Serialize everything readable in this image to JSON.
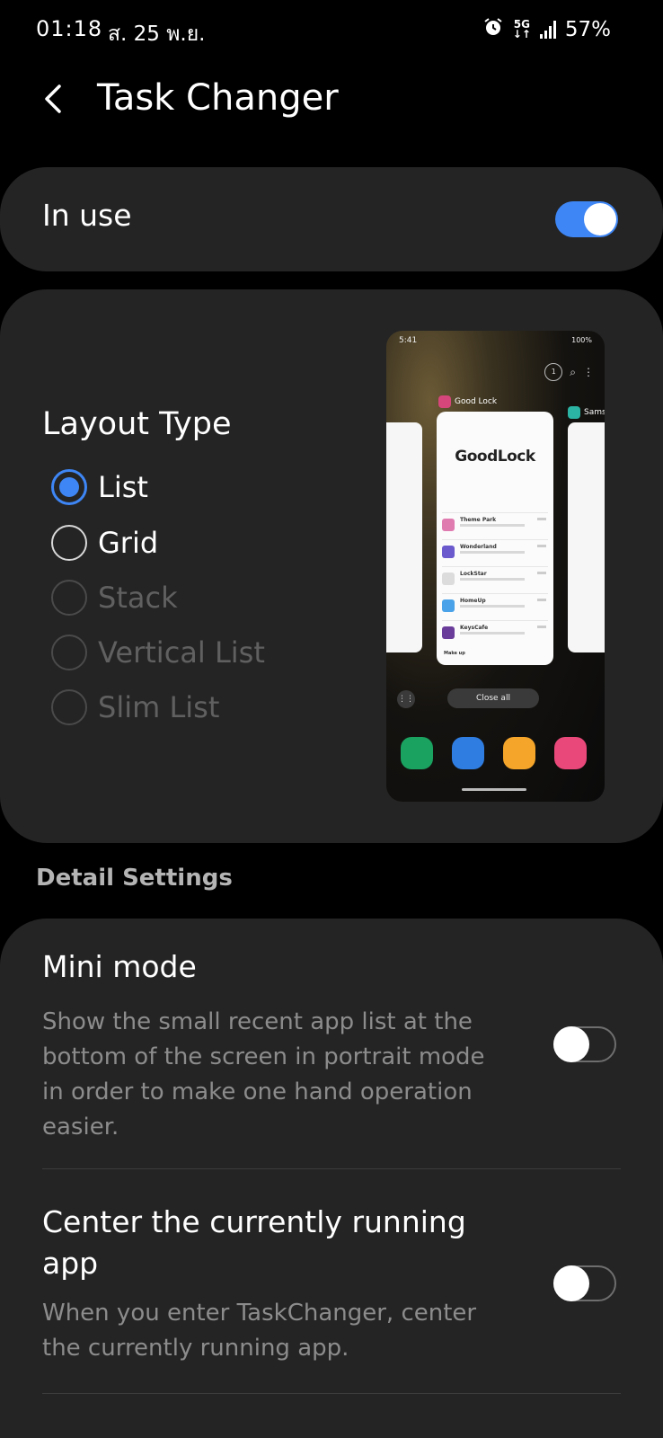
{
  "status_bar": {
    "time": "01:18",
    "date": "ส. 25 พ.ย.",
    "network": "5G",
    "battery": "57%"
  },
  "header": {
    "title": "Task Changer"
  },
  "in_use": {
    "label": "In use",
    "enabled": true
  },
  "layout": {
    "title": "Layout Type",
    "options": [
      {
        "label": "List",
        "selected": true,
        "enabled": true
      },
      {
        "label": "Grid",
        "selected": false,
        "enabled": true
      },
      {
        "label": "Stack",
        "selected": false,
        "enabled": false
      },
      {
        "label": "Vertical List",
        "selected": false,
        "enabled": false
      },
      {
        "label": "Slim List",
        "selected": false,
        "enabled": false
      }
    ],
    "preview": {
      "time": "5:41",
      "status": "100%",
      "badge": "1",
      "app_name": "Good Lock",
      "app_name_right": "Sams",
      "card_title": "GoodLock",
      "items": [
        "Theme Park",
        "Wonderland",
        "LockStar",
        "HomeUp",
        "KeysCafe"
      ],
      "footer": "Make up",
      "close_all": "Close all"
    }
  },
  "detail": {
    "section_title": "Detail Settings",
    "mini_mode": {
      "title": "Mini mode",
      "description_lines": [
        "Show the small recent app list at the",
        "bottom of the screen in portrait mode",
        "in order to make one hand operation",
        "easier."
      ],
      "enabled": false
    },
    "center_app": {
      "title_lines": [
        "Center the currently running",
        "app"
      ],
      "description_lines": [
        "When you enter TaskChanger, center",
        "the currently running app."
      ],
      "enabled": false
    }
  },
  "colors": {
    "accent": "#3e86f5",
    "card_bg": "#242424",
    "background": "#000000"
  }
}
